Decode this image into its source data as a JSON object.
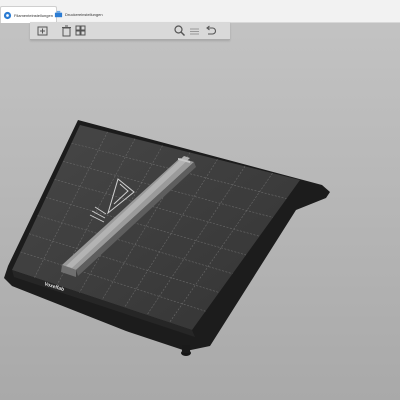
{
  "tabs": [
    {
      "label": "Filamenteinstellungen",
      "active": true,
      "icon": "filament-icon"
    },
    {
      "label": "Druckereinstellungen",
      "active": false,
      "icon": "printer-icon"
    }
  ],
  "toolbar": {
    "buttons": [
      "add-object-icon",
      "delete-icon",
      "arrange-icon",
      "zoom-icon",
      "layers-icon",
      "undo-icon"
    ]
  },
  "bed": {
    "brand_label": "Voxelfab"
  },
  "colors": {
    "background": "#b5b5b5",
    "bed_surface": "#3c3c3c",
    "bed_frame": "#1e1e1e",
    "grid_line": "#6a6a6a",
    "part": "#8a8a8a",
    "accent_blue": "#2b7cd3"
  }
}
